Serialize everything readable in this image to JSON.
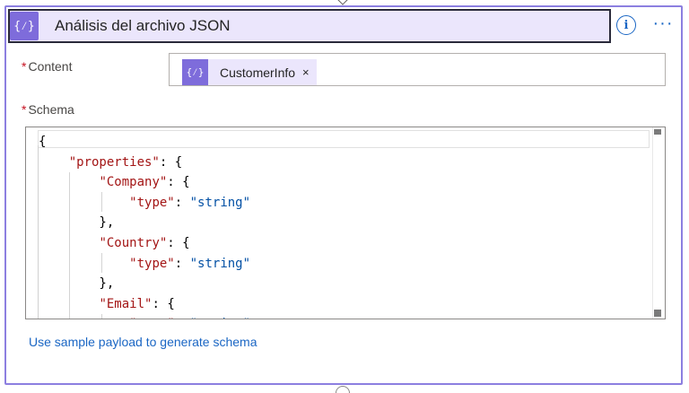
{
  "header": {
    "icon": "{⁄}",
    "title": "Análisis del archivo JSON",
    "info_icon": "i",
    "more_icon": "···"
  },
  "fields": {
    "content": {
      "required_mark": "*",
      "label": "Content",
      "token": {
        "icon": "{⁄}",
        "label": "CustomerInfo",
        "close": "×"
      }
    },
    "schema": {
      "required_mark": "*",
      "label": "Schema",
      "code_lines": [
        "{",
        "    \"properties\": {",
        "        \"Company\": {",
        "            \"type\": \"string\"",
        "        },",
        "        \"Country\": {",
        "            \"type\": \"string\"",
        "        },",
        "        \"Email\": {",
        "            \"type\": \"string\""
      ]
    }
  },
  "link": {
    "label": "Use sample payload to generate schema"
  },
  "colors": {
    "accent": "#8c7fe0",
    "header_bg": "#ebe6fc",
    "icon_bg": "#7e6cdb",
    "link": "#1a66c4",
    "json_key": "#a31515",
    "json_string": "#0451a5"
  }
}
